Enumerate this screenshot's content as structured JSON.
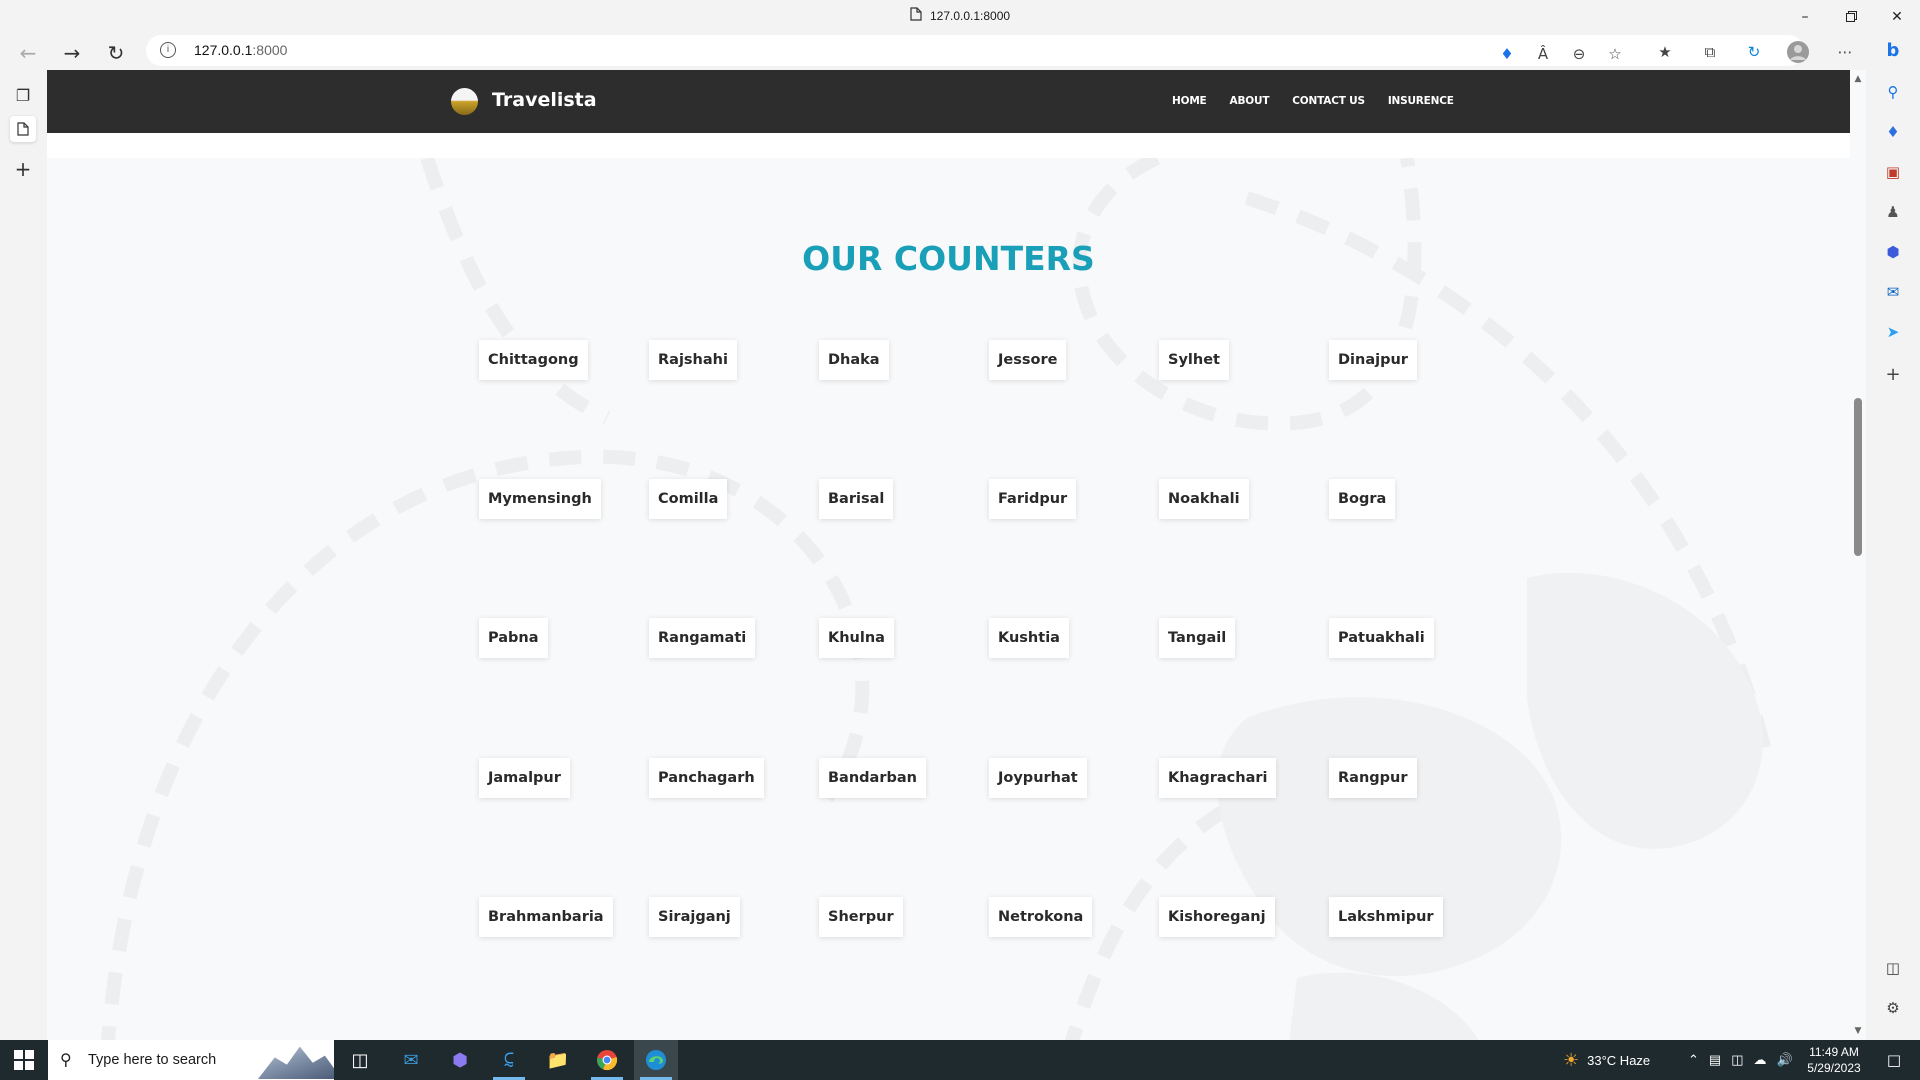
{
  "browser": {
    "tab_title": "127.0.0.1:8000",
    "url_host": "127.0.0.1",
    "url_port": ":8000"
  },
  "site": {
    "brand": "Travelista",
    "nav": [
      "HOME",
      "ABOUT",
      "CONTACT US",
      "INSURENCE"
    ],
    "section_title": "OUR COUNTERS",
    "counters": [
      [
        "Chittagong",
        "Rajshahi",
        "Dhaka",
        "Jessore",
        "Sylhet",
        "Dinajpur"
      ],
      [
        "Mymensingh",
        "Comilla",
        "Barisal",
        "Faridpur",
        "Noakhali",
        "Bogra"
      ],
      [
        "Pabna",
        "Rangamati",
        "Khulna",
        "Kushtia",
        "Tangail",
        "Patuakhali"
      ],
      [
        "Jamalpur",
        "Panchagarh",
        "Bandarban",
        "Joypurhat",
        "Khagrachari",
        "Rangpur"
      ],
      [
        "Brahmanbaria",
        "Sirajganj",
        "Sherpur",
        "Netrokona",
        "Kishoreganj",
        "Lakshmipur"
      ]
    ],
    "title_color": "#1a9fb8",
    "header_color": "#2d2d2d"
  },
  "taskbar": {
    "search_placeholder": "Type here to search",
    "weather": "33°C  Haze",
    "time": "11:49 AM",
    "date": "5/29/2023"
  },
  "icons": {
    "back": "arrow-left-icon",
    "forward": "arrow-right-icon",
    "refresh": "refresh-icon",
    "site_info": "info-icon"
  }
}
